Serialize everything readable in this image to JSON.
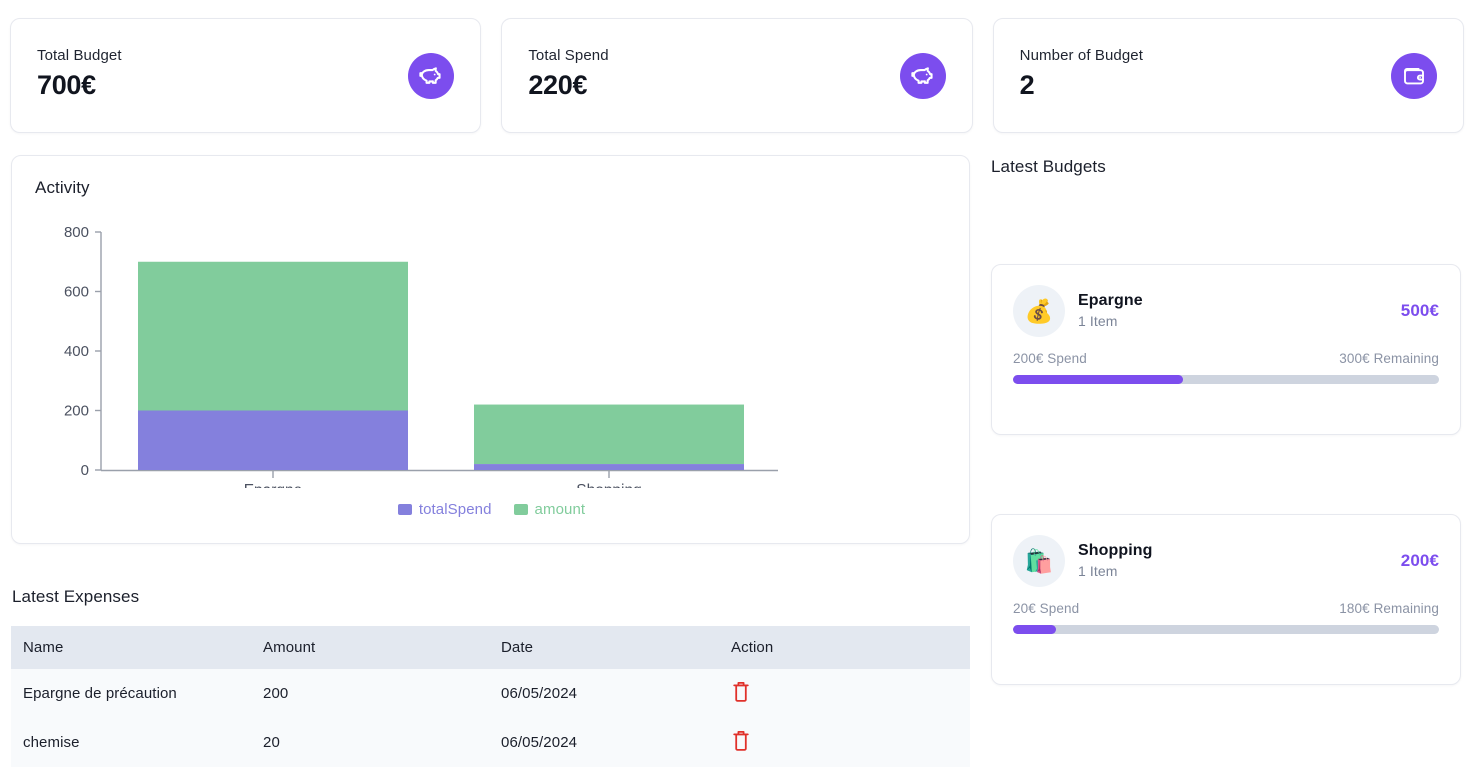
{
  "stats": [
    {
      "label": "Total Budget",
      "value": "700€",
      "icon": "piggy-bank-icon"
    },
    {
      "label": "Total Spend",
      "value": "220€",
      "icon": "piggy-bank-icon"
    },
    {
      "label": "Number of Budget",
      "value": "2",
      "icon": "wallet-icon"
    }
  ],
  "activity": {
    "title": "Activity"
  },
  "chart_data": {
    "type": "bar",
    "stacked": true,
    "title": "Activity",
    "xlabel": "",
    "ylabel": "",
    "categories": [
      "Epargne",
      "Shopping"
    ],
    "series": [
      {
        "name": "totalSpend",
        "color": "#8480dd",
        "values": [
          200,
          20
        ]
      },
      {
        "name": "amount",
        "color": "#81cc9c",
        "values": [
          500,
          200
        ]
      }
    ],
    "totals": [
      700,
      220
    ],
    "ylim": [
      0,
      800
    ],
    "yticks": [
      0,
      200,
      400,
      600,
      800
    ],
    "ytick_labels": [
      "0",
      "200",
      "400",
      "600",
      "800"
    ],
    "grid": false,
    "legend_position": "bottom",
    "legend": [
      "totalSpend",
      "amount"
    ]
  },
  "expenses": {
    "title": "Latest Expenses",
    "columns": [
      "Name",
      "Amount",
      "Date",
      "Action"
    ],
    "rows": [
      {
        "name": "Epargne de précaution",
        "amount": "200",
        "date": "06/05/2024",
        "action": "delete-icon"
      },
      {
        "name": "chemise",
        "amount": "20",
        "date": "06/05/2024",
        "action": "delete-icon"
      }
    ]
  },
  "budgets": {
    "title": "Latest Budgets",
    "items": [
      {
        "emoji": "💰",
        "name": "Epargne",
        "items_label": "1 Item",
        "amount": "500€",
        "spend_label": "200€ Spend",
        "remaining_label": "300€ Remaining",
        "progress_percent": 40
      },
      {
        "emoji": "🛍️",
        "name": "Shopping",
        "items_label": "1 Item",
        "amount": "200€",
        "spend_label": "20€ Spend",
        "remaining_label": "180€ Remaining",
        "progress_percent": 10
      }
    ]
  },
  "colors": {
    "accent": "#7c4dee",
    "series_total_spend": "#8480dd",
    "series_amount": "#81cc9c",
    "table_header_bg": "#e3e8f0",
    "table_row_bg": "#f8fafc",
    "delete_icon": "#e0312b",
    "progress_track": "#ced4df"
  }
}
